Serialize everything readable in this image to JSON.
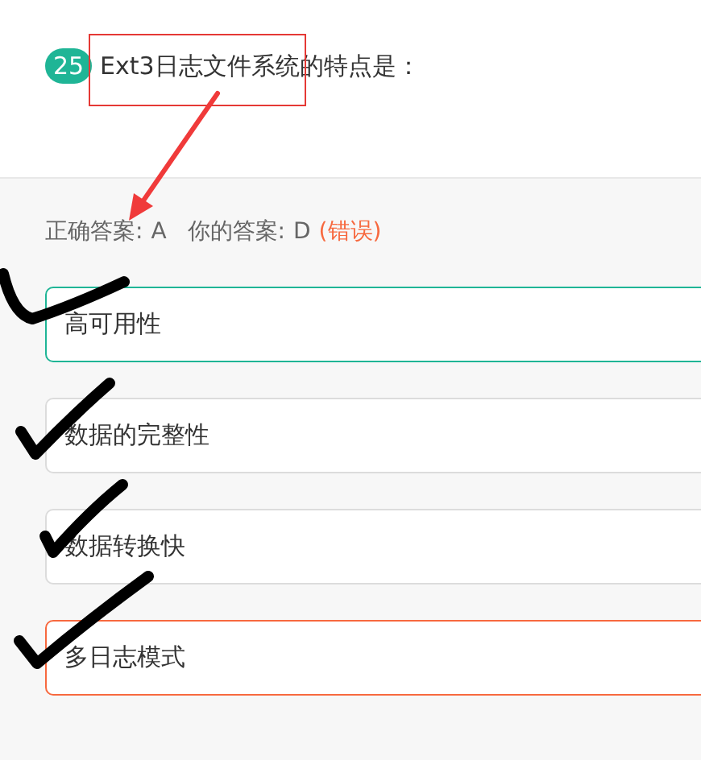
{
  "question": {
    "number": "25",
    "text": "Ext3日志文件系统的特点是："
  },
  "result": {
    "correct_label": "正确答案:",
    "correct_value": "A",
    "yours_label": "你的答案:",
    "yours_value": "D",
    "verdict": "(错误)"
  },
  "options": [
    {
      "text": "高可用性",
      "correct": true,
      "chosen": false
    },
    {
      "text": "数据的完整性",
      "correct": false,
      "chosen": false
    },
    {
      "text": "数据转换快",
      "correct": false,
      "chosen": false
    },
    {
      "text": "多日志模式",
      "correct": false,
      "chosen": true
    }
  ]
}
